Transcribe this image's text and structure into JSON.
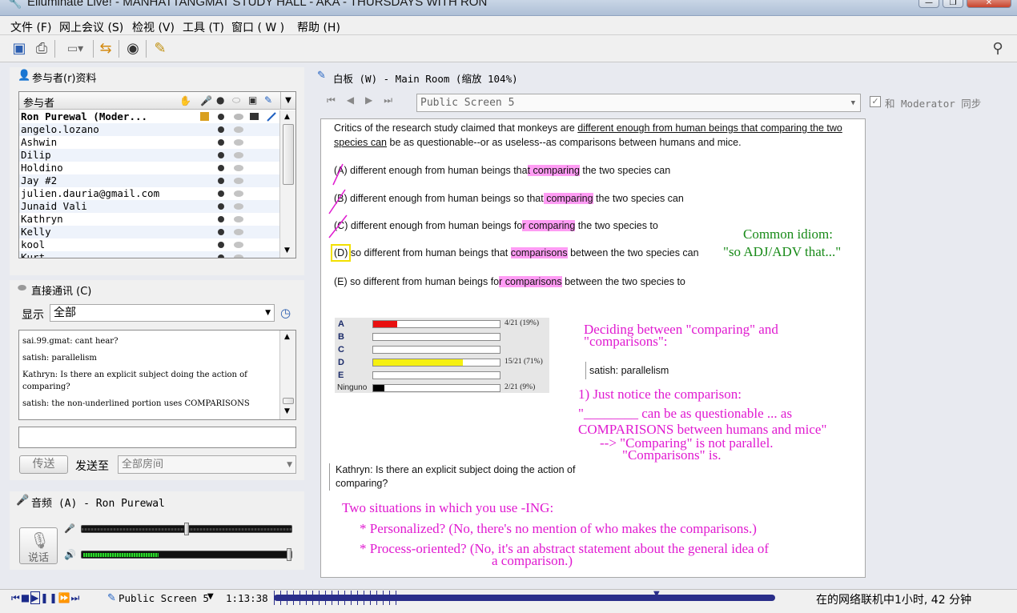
{
  "window": {
    "title": "Elluminate Live! - MANHATTANGMAT STUDY HALL - AKA - THURSDAYS WITH RON",
    "controls": [
      "—",
      "❐",
      "✕"
    ]
  },
  "menu": [
    "文件 (F)",
    "网上会议 (S)",
    "检视 (V)",
    "工具 (T)",
    "窗口 ( W )",
    "帮助 (H)"
  ],
  "participants": {
    "title": "参与者(r)资料",
    "column_header": "参与者",
    "rows": [
      "Ron Purewal (Moder...",
      "angelo.lozano",
      "Ashwin",
      "Dilip",
      "Holdino",
      "Jay #2",
      "julien.dauria@gmail.com",
      "Junaid Vali",
      "Kathryn",
      "Kelly",
      "kool",
      "Kurt"
    ]
  },
  "chat": {
    "title": "直接通讯 (C)",
    "show_label": "显示",
    "show_value": "全部",
    "messages": [
      "sai.99.gmat: cant hear?",
      "satish: parallelism",
      "Kathryn: Is there an explicit subject doing the action of comparing?",
      "satish: the non-underlined portion uses COMPARISONS"
    ],
    "send_label": "传送",
    "send_to_label": "发送至",
    "send_to_value": "全部房间"
  },
  "audio": {
    "title": "音频 (A) - Ron Purewal",
    "talk_label": "说话"
  },
  "whiteboard": {
    "title": "白板 (W) - Main Room (缩放 104%)",
    "screen_select": "Public Screen 5",
    "sync_label": "和 Moderator 同步",
    "question": {
      "stem_a": "Critics of the research study claimed that monkeys are ",
      "stem_u1": "different enough from human beings that comparing the two",
      "stem_u2": "species can",
      "stem_b": " be as questionable--or as useless--as comparisons between humans and mice.",
      "choices": [
        {
          "pre": "(A) different enough from human beings tha",
          "hl": "t comparing",
          "post": " the two species can"
        },
        {
          "pre": "(B) different enough from human beings so that",
          "hl": " comparing",
          "post": " the two species can"
        },
        {
          "pre": "(C) different enough from human beings fo",
          "hl": "r comparing",
          "post": " the two species to"
        },
        {
          "pre": "(D)",
          "mid": " so different from human beings that ",
          "hl": "comparisons",
          "post": " between the two species can"
        },
        {
          "pre": "(E) so different from human beings fo",
          "hl": "r comparisons",
          "post": " between the two species to"
        }
      ]
    },
    "idiom_line1": "Common idiom:",
    "idiom_line2": "\"so ADJ/ADV that...\"",
    "poll": {
      "rows": [
        {
          "label": "A",
          "fraction": 0.19,
          "color": "#e81010",
          "text": "4/21 (19%)"
        },
        {
          "label": "B",
          "fraction": 0,
          "color": "#ffffff",
          "text": ""
        },
        {
          "label": "C",
          "fraction": 0,
          "color": "#ffffff",
          "text": ""
        },
        {
          "label": "D",
          "fraction": 0.71,
          "color": "#f5f010",
          "text": "15/21 (71%)"
        },
        {
          "label": "E",
          "fraction": 0,
          "color": "#ffffff",
          "text": ""
        },
        {
          "label": "Ninguno",
          "fraction": 0.09,
          "color": "#000000",
          "text": "2/21 (9%)"
        }
      ]
    },
    "notes": {
      "deciding1": "Deciding between \"comparing\" and",
      "deciding2": "\"comparisons\":",
      "quote_satish": "satish: parallelism",
      "notice": "1) Just notice the comparison:",
      "blank": "\"________ can be as questionable ... as",
      "comparisons_line": "COMPARISONS between humans and mice\"",
      "arrow1": "--> \"Comparing\" is not parallel.",
      "arrow2": "\"Comparisons\" is.",
      "quote_kathryn1": "Kathryn: Is there an explicit subject doing the action of",
      "quote_kathryn2": "comparing?",
      "two_situations": "Two situations in which you use -ING:",
      "personalized": "* Personalized?  (No, there's no mention of who makes the comparisons.)",
      "process1": "* Process-oriented?  (No, it's an abstract statement about the general idea of",
      "process2": "a comparison.)"
    }
  },
  "status": {
    "screen": "Public Screen 5",
    "time": "1:13:38",
    "online": "在的网络联机中1小时, 42 分钟"
  }
}
